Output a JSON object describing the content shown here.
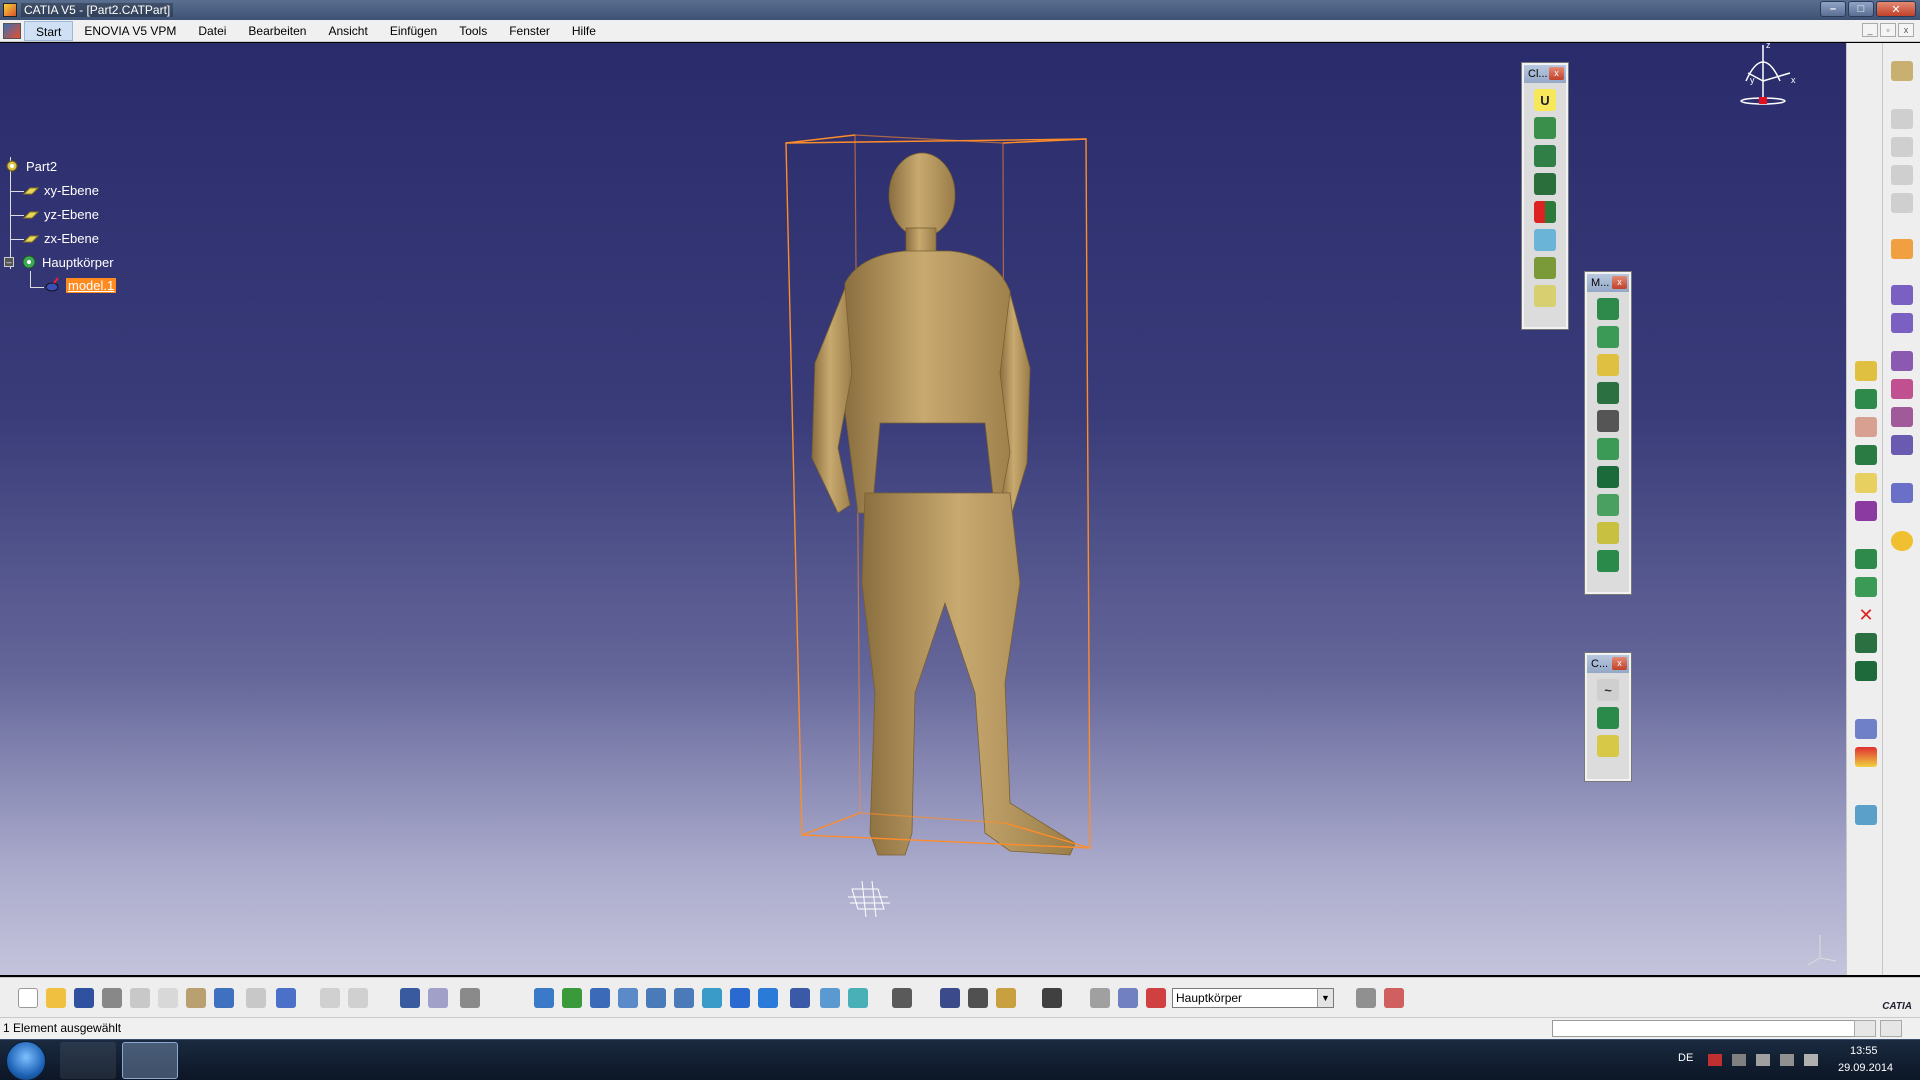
{
  "window": {
    "title": "CATIA V5 - [Part2.CATPart]",
    "buttons": {
      "minimize": "–",
      "maximize": "□",
      "close": "✕"
    }
  },
  "menu": {
    "items": [
      "Start",
      "ENOVIA V5 VPM",
      "Datei",
      "Bearbeiten",
      "Ansicht",
      "Einfügen",
      "Tools",
      "Fenster",
      "Hilfe"
    ]
  },
  "tree": {
    "root": "Part2",
    "planes": [
      "xy-Ebene",
      "yz-Ebene",
      "zx-Ebene"
    ],
    "body": "Hauptkörper",
    "model": "model.1"
  },
  "floating_toolbars": [
    {
      "title": "Cl...",
      "icon_count": 8
    },
    {
      "title": "M...",
      "icon_count": 10
    },
    {
      "title": "C...",
      "icon_count": 3
    }
  ],
  "compass": {
    "x": "x",
    "y": "y",
    "z": "z"
  },
  "bottom_toolbar": {
    "body_selector": "Hauptkörper"
  },
  "status": {
    "text": "1 Element ausgewählt"
  },
  "taskbar": {
    "language": "DE",
    "time": "13:55",
    "date": "29.09.2014"
  },
  "brand": {
    "logo_text": "CATIA"
  },
  "colors": {
    "viewport_top": "#292b6b",
    "viewport_bottom": "#c4c4dc",
    "model": "#b9995f",
    "bbox": "#ff8c2a",
    "selection": "#ff8a1e"
  }
}
